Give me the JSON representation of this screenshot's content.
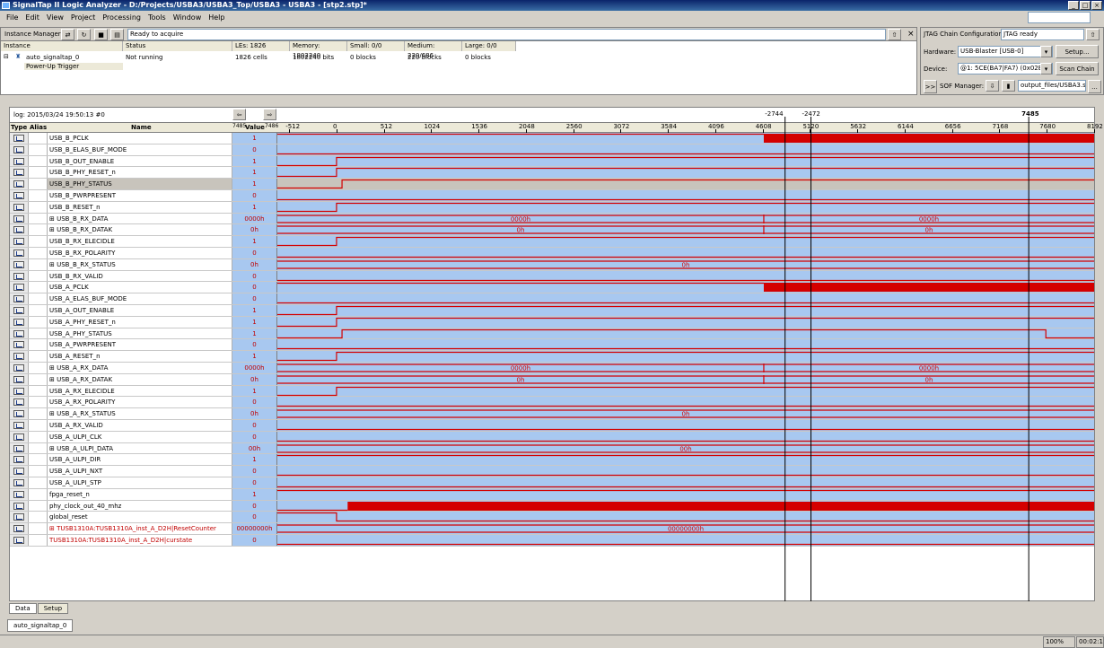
{
  "window": {
    "title": "SignalTap II Logic Analyzer - D:/Projects/USBA3/USBA3_Top/USBA3 - USBA3 - [stp2.stp]*"
  },
  "menu": [
    "File",
    "Edit",
    "View",
    "Project",
    "Processing",
    "Tools",
    "Window",
    "Help"
  ],
  "instance_manager": {
    "label": "Instance Manager:",
    "status": "Ready to acquire",
    "headers": [
      "Instance",
      "Status",
      "LEs: 1826",
      "Memory: 1802240",
      "Small: 0/0",
      "Medium: 220/686",
      "Large: 0/0"
    ],
    "row": [
      "auto_signaltap_0",
      "Not running",
      "1826 cells",
      "1802240 bits",
      "0 blocks",
      "220 blocks",
      "0 blocks"
    ],
    "child": "Power-Up Trigger"
  },
  "jtag": {
    "label": "JTAG Chain Configuration:",
    "status": "JTAG ready",
    "hardware_label": "Hardware:",
    "hardware": "USB-Blaster [USB-0]",
    "setup": "Setup...",
    "device_label": "Device:",
    "device": "@1: 5CE(BA7|FA7) (0x02B13",
    "scan": "Scan Chain",
    "sof_btn": ">>",
    "sof_label": "SOF Manager:",
    "sof_file": "output_files/USBA3.sof",
    "browse": "..."
  },
  "log": "log: 2015/03/24 19:50:13  #0",
  "columns": {
    "type": "Type",
    "alias": "Alias",
    "name": "Name",
    "value": "Value",
    "value_ticks": [
      "7485",
      "7486"
    ]
  },
  "timeline": {
    "marks": [
      "-512",
      "0",
      "512",
      "1024",
      "1536",
      "2048",
      "2560",
      "3072",
      "3584",
      "4096",
      "4608",
      "5120",
      "5632",
      "6144",
      "6656",
      "7168",
      "7680",
      "8192"
    ],
    "cursor_a": "-2744",
    "cursor_b": "-2472",
    "cursor_c": "7485"
  },
  "signals": [
    {
      "name": "USB_B_PCLK",
      "value": "1",
      "kind": "clk_right"
    },
    {
      "name": "USB_B_ELAS_BUF_MODE",
      "value": "0",
      "kind": "low"
    },
    {
      "name": "USB_B_OUT_ENABLE",
      "value": "1",
      "kind": "rise0"
    },
    {
      "name": "USB_B_PHY_RESET_n",
      "value": "1",
      "kind": "rise0"
    },
    {
      "name": "USB_B_PHY_STATUS",
      "value": "1",
      "kind": "rise_late",
      "sel": true
    },
    {
      "name": "USB_B_PWRPRESENT",
      "value": "0",
      "kind": "low"
    },
    {
      "name": "USB_B_RESET_n",
      "value": "1",
      "kind": "rise0"
    },
    {
      "name": "USB_B_RX_DATA",
      "value": "0000h",
      "kind": "bus",
      "bus": [
        "0000h",
        "0000h"
      ],
      "group": true
    },
    {
      "name": "USB_B_RX_DATAK",
      "value": "0h",
      "kind": "bus",
      "bus": [
        "0h",
        "0h"
      ],
      "group": true
    },
    {
      "name": "USB_B_RX_ELECIDLE",
      "value": "1",
      "kind": "rise0"
    },
    {
      "name": "USB_B_RX_POLARITY",
      "value": "0",
      "kind": "low"
    },
    {
      "name": "USB_B_RX_STATUS",
      "value": "0h",
      "kind": "bus1",
      "bus": [
        "0h"
      ],
      "group": true
    },
    {
      "name": "USB_B_RX_VALID",
      "value": "0",
      "kind": "low"
    },
    {
      "name": "USB_A_PCLK",
      "value": "0",
      "kind": "clk_right"
    },
    {
      "name": "USB_A_ELAS_BUF_MODE",
      "value": "0",
      "kind": "low"
    },
    {
      "name": "USB_A_OUT_ENABLE",
      "value": "1",
      "kind": "rise0"
    },
    {
      "name": "USB_A_PHY_RESET_n",
      "value": "1",
      "kind": "rise0"
    },
    {
      "name": "USB_A_PHY_STATUS",
      "value": "1",
      "kind": "rise_fall"
    },
    {
      "name": "USB_A_PWRPRESENT",
      "value": "0",
      "kind": "low"
    },
    {
      "name": "USB_A_RESET_n",
      "value": "1",
      "kind": "rise0"
    },
    {
      "name": "USB_A_RX_DATA",
      "value": "0000h",
      "kind": "bus",
      "bus": [
        "0000h",
        "0000h"
      ],
      "group": true
    },
    {
      "name": "USB_A_RX_DATAK",
      "value": "0h",
      "kind": "bus",
      "bus": [
        "0h",
        "0h"
      ],
      "group": true
    },
    {
      "name": "USB_A_RX_ELECIDLE",
      "value": "1",
      "kind": "rise0"
    },
    {
      "name": "USB_A_RX_POLARITY",
      "value": "0",
      "kind": "low"
    },
    {
      "name": "USB_A_RX_STATUS",
      "value": "0h",
      "kind": "bus1",
      "bus": [
        "0h"
      ],
      "group": true
    },
    {
      "name": "USB_A_RX_VALID",
      "value": "0",
      "kind": "low"
    },
    {
      "name": "USB_A_ULPI_CLK",
      "value": "0",
      "kind": "low"
    },
    {
      "name": "USB_A_ULPI_DATA",
      "value": "00h",
      "kind": "bus1",
      "bus": [
        "00h"
      ],
      "group": true
    },
    {
      "name": "USB_A_ULPI_DIR",
      "value": "1",
      "kind": "high"
    },
    {
      "name": "USB_A_ULPI_NXT",
      "value": "0",
      "kind": "low"
    },
    {
      "name": "USB_A_ULPI_STP",
      "value": "0",
      "kind": "low"
    },
    {
      "name": "fpga_reset_n",
      "value": "1",
      "kind": "high"
    },
    {
      "name": "phy_clock_out_40_mhz",
      "value": "0",
      "kind": "clk_full"
    },
    {
      "name": "global_reset",
      "value": "0",
      "kind": "fall0"
    },
    {
      "name": "TUSB1310A:TUSB1310A_inst_A_D2H|ResetCounter",
      "value": "00000000h",
      "kind": "bus1",
      "bus": [
        "00000000h"
      ],
      "group": true,
      "red": true
    },
    {
      "name": "TUSB1310A:TUSB1310A_inst_A_D2H|curstate",
      "value": "0",
      "kind": "low",
      "red": true
    }
  ],
  "tabs": [
    "Data",
    "Setup"
  ],
  "instance_tab": "auto_signaltap_0",
  "statusbar": {
    "zoom": "100%",
    "time": "00:02:11"
  }
}
